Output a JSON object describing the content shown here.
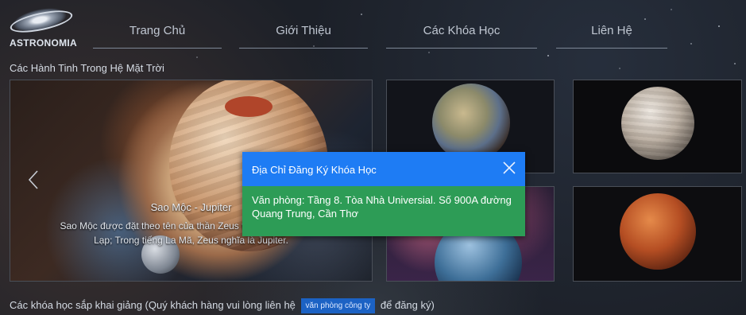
{
  "brand": {
    "name": "ASTRONOMIA"
  },
  "nav": {
    "items": [
      {
        "label": "Trang Chủ"
      },
      {
        "label": "Giới Thiệu"
      },
      {
        "label": "Các Khóa Học"
      },
      {
        "label": "Liên Hệ"
      }
    ]
  },
  "section": {
    "title": "Các Hành Tinh Trong Hệ Mặt Trời"
  },
  "carousel": {
    "caption_title": "Sao Mộc - Jupiter",
    "caption_text": "Sao Mộc được đặt theo tên của thần Zeus trong thần thoại Hy Lạp; Trong tiếng La Mã, Zeus nghĩa là Jupiter."
  },
  "modal": {
    "title": "Địa Chỉ Đăng Ký Khóa Học",
    "body": "Văn phòng: Tầng 8. Tòa Nhà Universial. Số 900A đường Quang Trung, Cần Thơ"
  },
  "footer": {
    "before": "Các khóa học sắp khai giảng (Quý khách hàng vui lòng liên hệ",
    "button": "văn phòng công ty",
    "after": "để đăng ký)"
  },
  "colors": {
    "modal_header": "#1e7cf4",
    "modal_body": "#2d9c56",
    "office_button": "#1c62c4"
  },
  "icons": {
    "logo": "galaxy-icon",
    "carousel_prev": "chevron-left-icon",
    "modal_close": "close-icon"
  }
}
